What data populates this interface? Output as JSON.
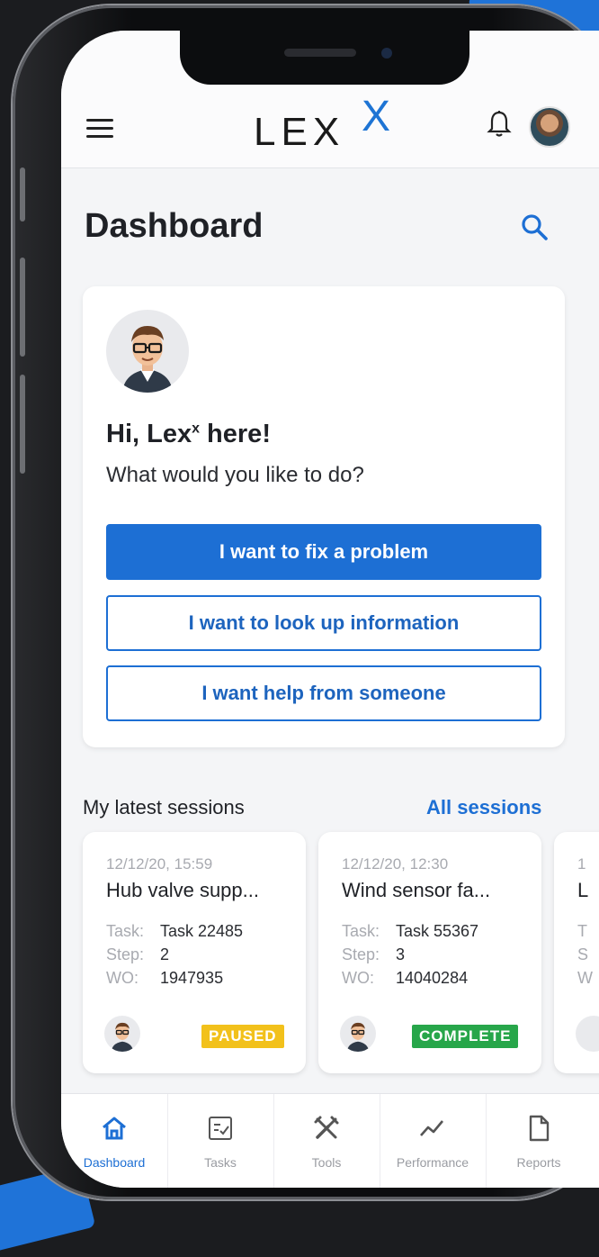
{
  "app": {
    "logo_text": "LEX",
    "logo_superscript": "X"
  },
  "header": {
    "menu_icon": "hamburger-icon",
    "bell_icon": "bell-icon",
    "avatar": "user-avatar"
  },
  "page": {
    "title": "Dashboard",
    "search_icon": "search-icon"
  },
  "assistant": {
    "greeting_prefix": "Hi, Lex",
    "greeting_sup": "x",
    "greeting_suffix": " here!",
    "prompt": "What would you like to do?",
    "buttons": [
      {
        "label": "I want to fix a problem"
      },
      {
        "label": "I want to look up information"
      },
      {
        "label": "I want help from someone"
      }
    ]
  },
  "sessions": {
    "title": "My latest sessions",
    "all_link": "All sessions",
    "items": [
      {
        "date": "12/12/20, 15:59",
        "title": "Hub valve supp...",
        "task_label": "Task:",
        "task": "Task 22485",
        "step_label": "Step:",
        "step": "2",
        "wo_label": "WO:",
        "wo": "1947935",
        "status": "PAUSED",
        "status_color": "#f2c11b"
      },
      {
        "date": "12/12/20, 12:30",
        "title": "Wind sensor fa...",
        "task_label": "Task:",
        "task": "Task 55367",
        "step_label": "Step:",
        "step": "3",
        "wo_label": "WO:",
        "wo": "14040284",
        "status": "COMPLETE",
        "status_color": "#27a64a"
      },
      {
        "date": "1",
        "title": "L",
        "task_label": "T",
        "task": "",
        "step_label": "S",
        "step": "",
        "wo_label": "W",
        "wo": "",
        "status": "",
        "status_color": ""
      }
    ]
  },
  "nav": {
    "items": [
      {
        "label": "Dashboard",
        "icon": "home-icon",
        "active": true
      },
      {
        "label": "Tasks",
        "icon": "tasks-icon",
        "active": false
      },
      {
        "label": "Tools",
        "icon": "tools-icon",
        "active": false
      },
      {
        "label": "Performance",
        "icon": "performance-icon",
        "active": false
      },
      {
        "label": "Reports",
        "icon": "reports-icon",
        "active": false
      }
    ]
  },
  "colors": {
    "accent": "#1d6fd4",
    "logo_accent": "#1e74d4",
    "paused": "#f2c11b",
    "complete": "#27a64a"
  }
}
